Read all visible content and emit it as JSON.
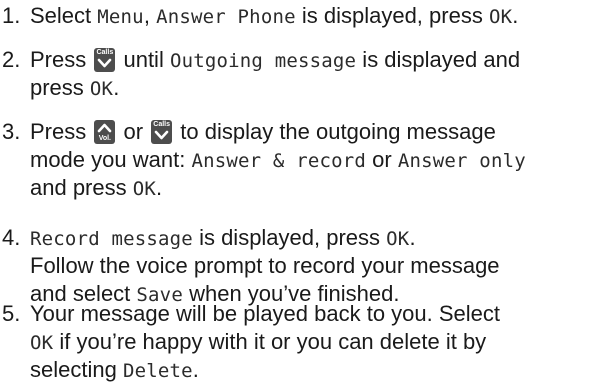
{
  "steps": [
    {
      "num": "1.",
      "lines": [
        [
          {
            "t": "Select "
          },
          {
            "lcd": "Menu"
          },
          {
            "t": ", "
          },
          {
            "lcd": "Answer Phone"
          },
          {
            "t": " is displayed, press "
          },
          {
            "lcd": "OK"
          },
          {
            "t": "."
          }
        ]
      ]
    },
    {
      "num": "2.",
      "lines": [
        [
          {
            "t": "Press "
          },
          {
            "key": "calls"
          },
          {
            "t": " until "
          },
          {
            "lcd": "Outgoing message"
          },
          {
            "t": " is displayed and"
          }
        ],
        [
          {
            "t": "press "
          },
          {
            "lcd": "OK"
          },
          {
            "t": "."
          }
        ]
      ]
    },
    {
      "num": "3.",
      "lines": [
        [
          {
            "t": "Press "
          },
          {
            "key": "vol"
          },
          {
            "t": " or "
          },
          {
            "key": "calls"
          },
          {
            "t": " to display the outgoing message"
          }
        ],
        [
          {
            "t": "mode you want: "
          },
          {
            "lcd": "Answer & record"
          },
          {
            "t": " or "
          },
          {
            "lcd": "Answer only"
          }
        ],
        [
          {
            "t": "and press "
          },
          {
            "lcd": "OK"
          },
          {
            "t": "."
          }
        ]
      ]
    },
    {
      "num": "4.",
      "lines": [
        [
          {
            "lcd": "Record message"
          },
          {
            "t": " is displayed, press "
          },
          {
            "lcd": "OK"
          },
          {
            "t": "."
          }
        ],
        [
          {
            "t": "Follow the voice prompt to record your message"
          }
        ],
        [
          {
            "t": "and select "
          },
          {
            "lcd": "Save"
          },
          {
            "t": " when you’ve finished."
          }
        ]
      ]
    },
    {
      "num": "5.",
      "lines": [
        [
          {
            "t": "Your message will be played back to you. Select"
          }
        ],
        [
          {
            "lcd": "OK"
          },
          {
            "t": " if you’re happy with it or you can delete it by"
          }
        ],
        [
          {
            "t": "selecting "
          },
          {
            "lcd": "Delete"
          },
          {
            "t": "."
          }
        ]
      ]
    }
  ],
  "keys": {
    "calls": {
      "label": "Calls",
      "icon": "chevron-down-icon"
    },
    "vol": {
      "label": "Vol.",
      "icon": "chevron-up-icon"
    }
  },
  "colors": {
    "text": "#1a1a1a",
    "key_bg": "#4d4d4d",
    "key_fg": "#ffffff"
  }
}
